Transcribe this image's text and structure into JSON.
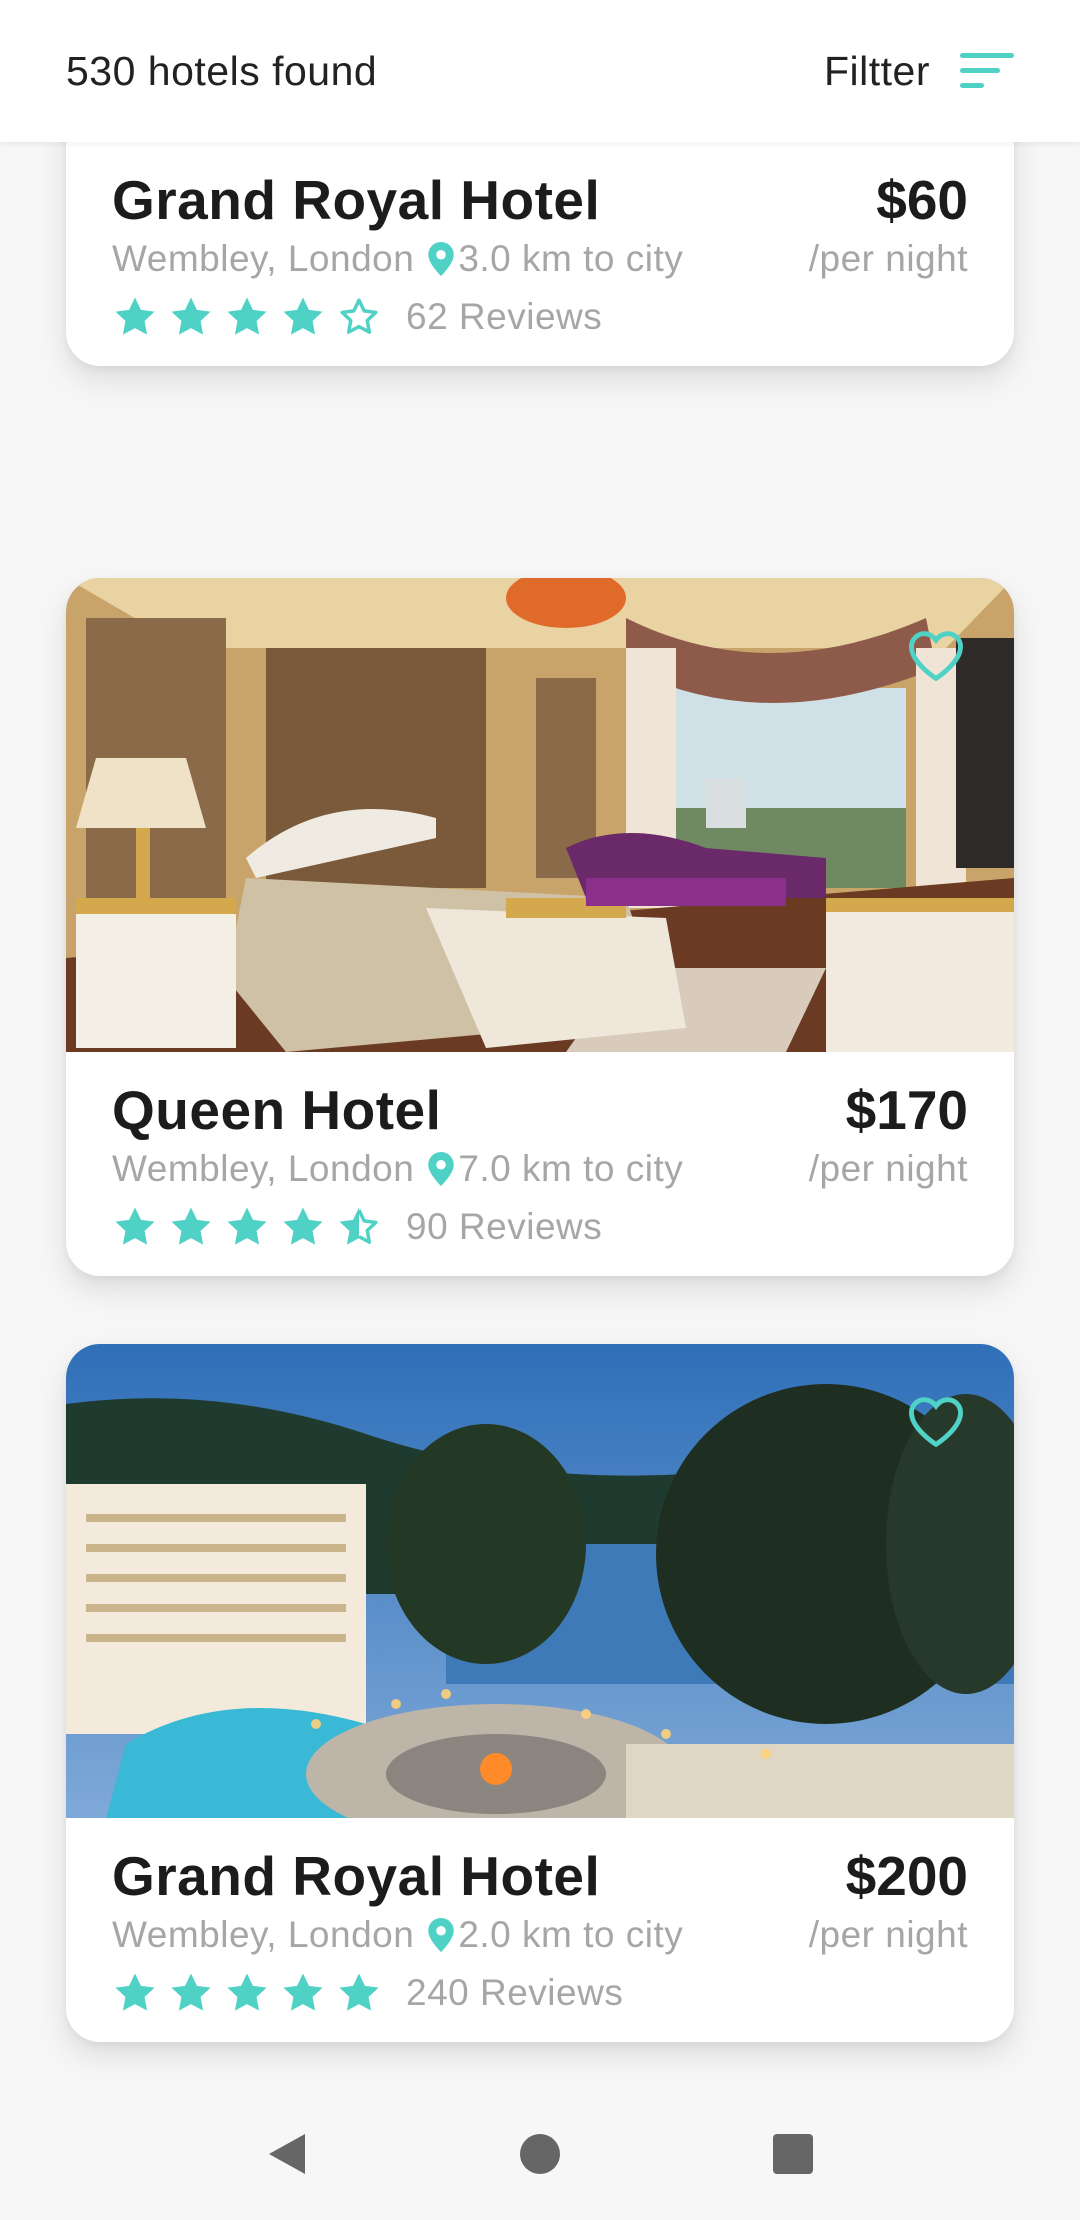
{
  "header": {
    "results_text": "530 hotels found",
    "filter_label": "Filtter"
  },
  "colors": {
    "accent": "#4fd1c5",
    "text_primary": "#1c1c1c",
    "text_muted": "#a6a6a6"
  },
  "hotels": [
    {
      "name": "Grand Royal Hotel",
      "price": "$60",
      "place": "Wembley, London",
      "distance": "3.0 km to city",
      "per_night": "/per night",
      "rating": 4,
      "reviews": "62 Reviews",
      "image": "overwater-villa-deck-image"
    },
    {
      "name": "Queen Hotel",
      "price": "$170",
      "place": "Wembley, London",
      "distance": "7.0 km to city",
      "per_night": "/per night",
      "rating": 4.5,
      "reviews": "90 Reviews",
      "image": "luxury-bedroom-image"
    },
    {
      "name": "Grand Royal Hotel",
      "price": "$200",
      "place": "Wembley, London",
      "distance": "2.0 km to city",
      "per_night": "/per night",
      "rating": 5,
      "reviews": "240 Reviews",
      "image": "beach-resort-image"
    }
  ],
  "navbar": {
    "icons": [
      "back-icon",
      "home-icon",
      "recents-icon"
    ]
  }
}
